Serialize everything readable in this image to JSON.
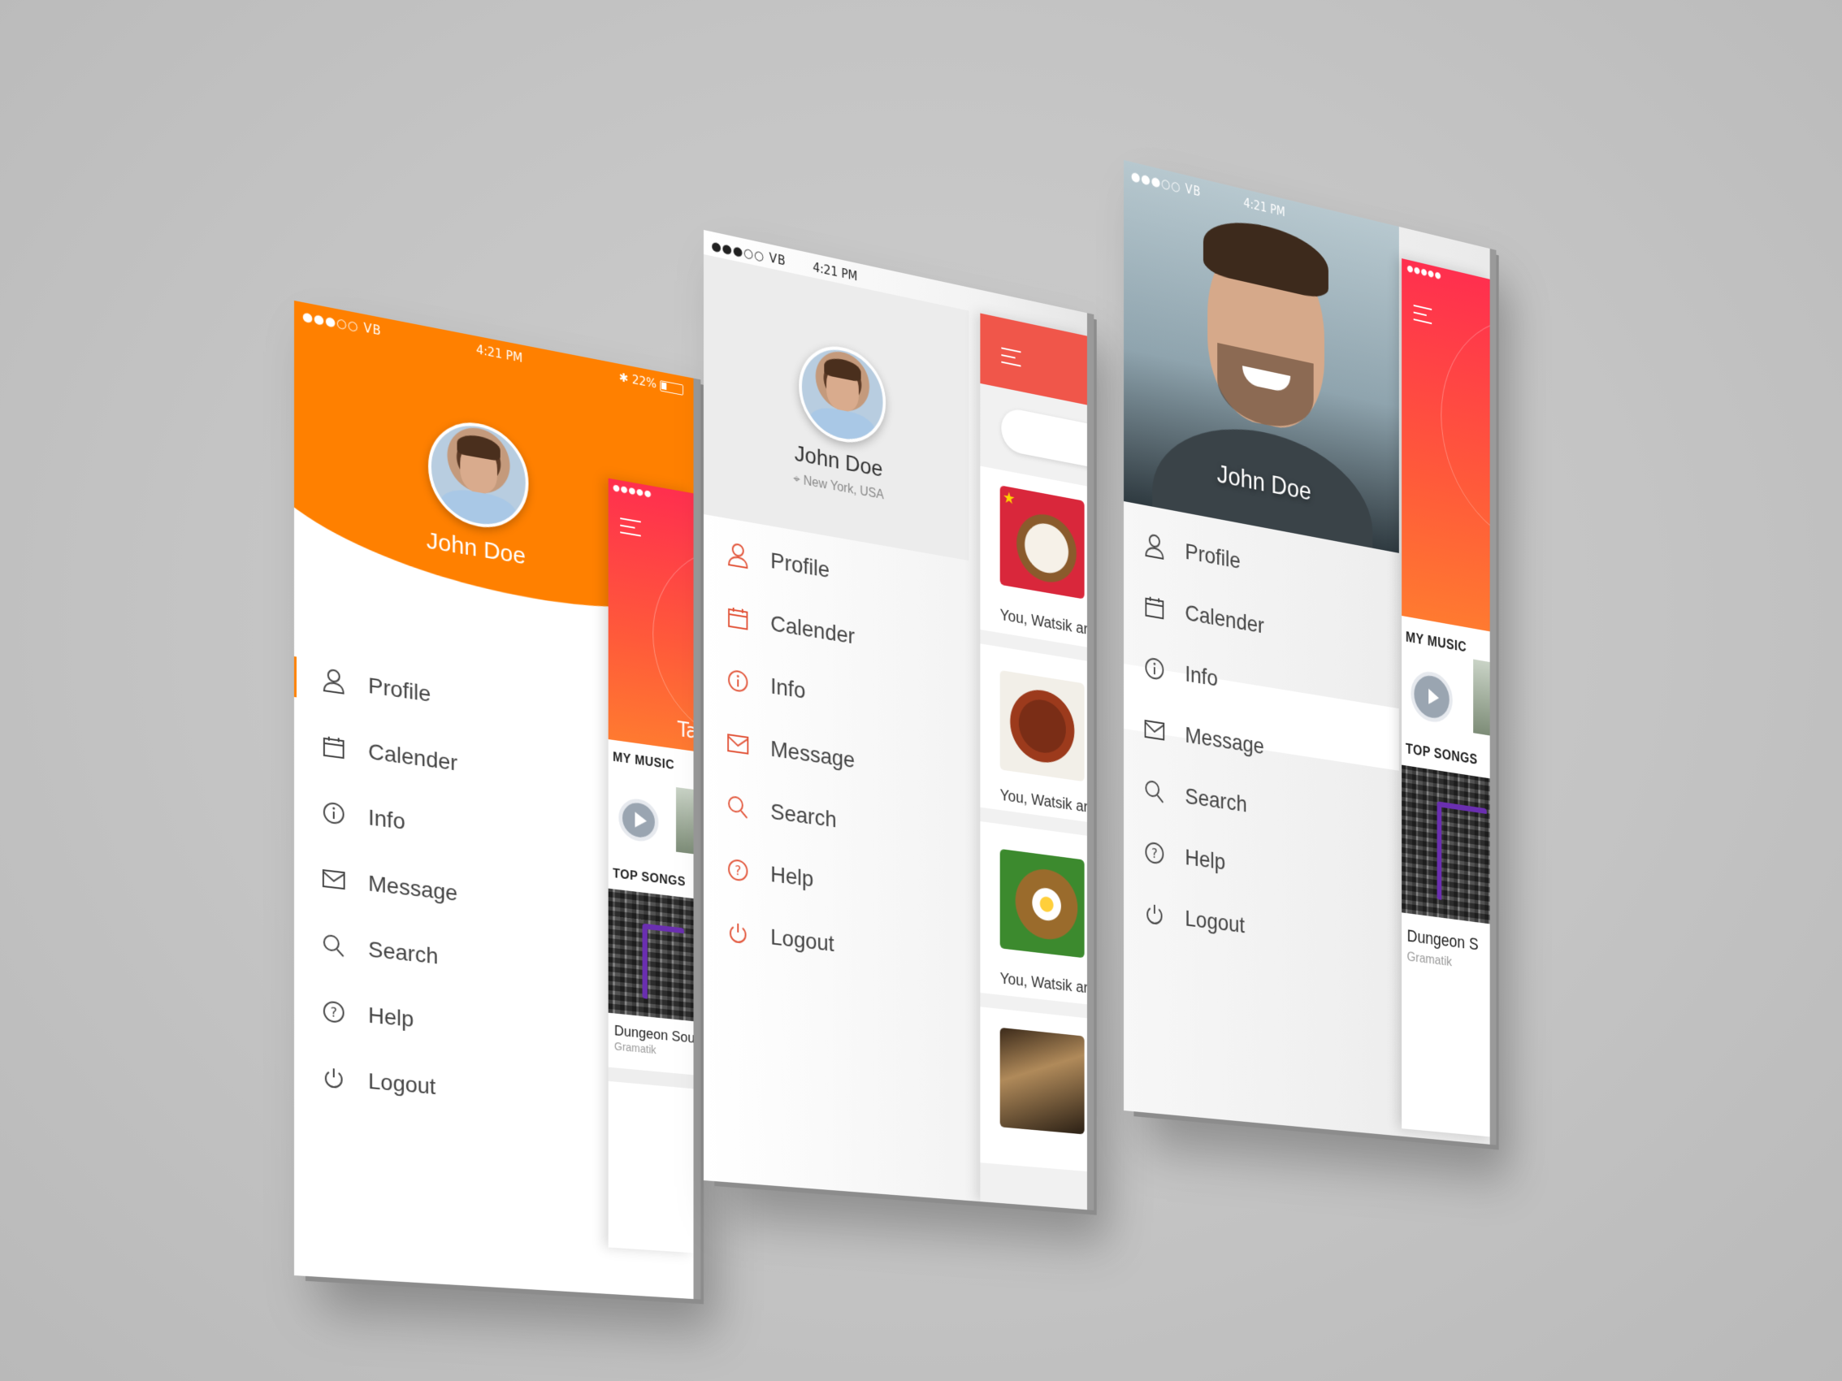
{
  "accent": "#ff7f00",
  "brand_red": "#ff3b4e",
  "status": {
    "signal": "●●●○○ VB",
    "time": "4:21 PM",
    "battery": "22%"
  },
  "profile": {
    "name": "John Doe",
    "location": "New York, USA"
  },
  "menu": [
    {
      "label": "Profile",
      "icon": "user-icon"
    },
    {
      "label": "Calender",
      "icon": "calendar-icon"
    },
    {
      "label": "Info",
      "icon": "info-icon"
    },
    {
      "label": "Message",
      "icon": "mail-icon"
    },
    {
      "label": "Search",
      "icon": "search-icon"
    },
    {
      "label": "Help",
      "icon": "help-icon"
    },
    {
      "label": "Logout",
      "icon": "power-icon"
    }
  ],
  "music": {
    "hero_text": "Ta",
    "my_music": "MY MUSIC",
    "top_songs": "TOP SONGS",
    "song_title_short": "Dungeon Sou",
    "song_title_short2": "Dungeon S",
    "artist": "Gramatik"
  },
  "feed": {
    "caption": "You, Watsik ar"
  }
}
